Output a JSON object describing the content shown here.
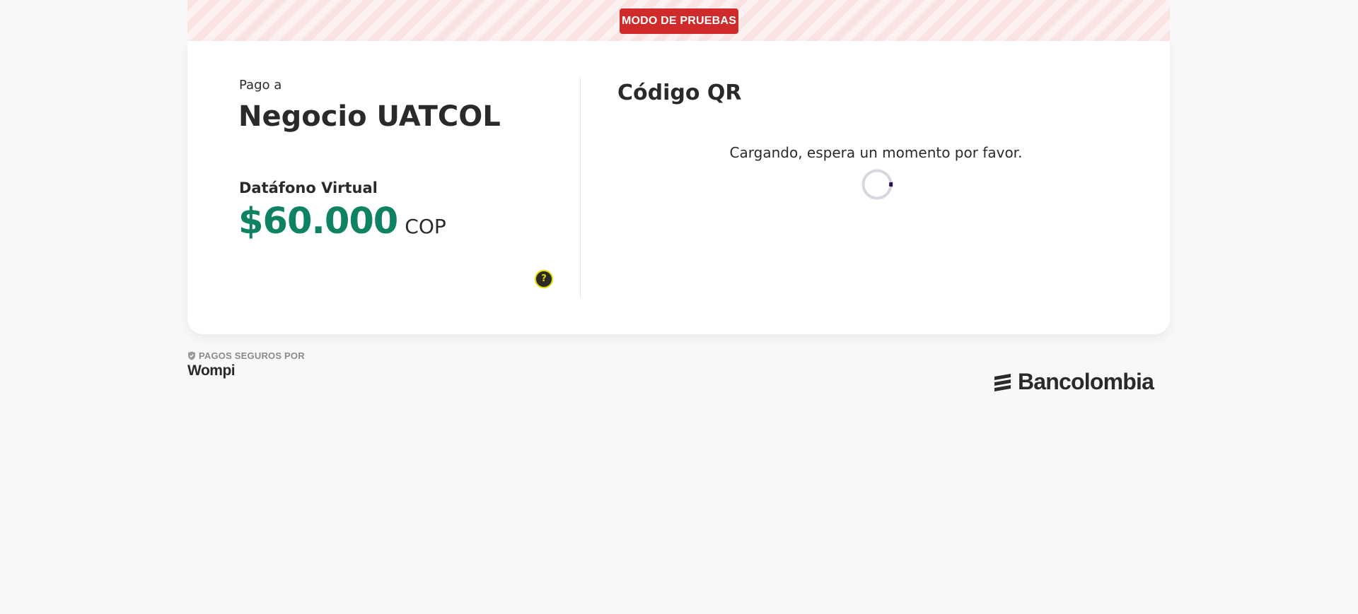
{
  "banner": {
    "badge_label": "MODO DE PRUEBAS"
  },
  "summary": {
    "pay_to_label": "Pago a",
    "merchant_name": "Negocio UATCOL",
    "product_name": "Datáfono Virtual",
    "amount": "$60.000",
    "currency": "COP",
    "help_glyph": "?"
  },
  "qr": {
    "title": "Código QR",
    "loading_text": "Cargando, espera un momento por favor."
  },
  "footer": {
    "secure_label": "PAGOS SEGUROS POR",
    "provider": "Wompi",
    "bank": "Bancolombia"
  },
  "colors": {
    "test_badge": "#d02b2b",
    "amount": "#0f8264",
    "help_ring": "#dfdb00",
    "spinner_accent": "#2a0d55"
  },
  "icons": [
    "shield-check-icon",
    "help-icon",
    "loading-spinner-icon",
    "bancolombia-logo-icon"
  ]
}
